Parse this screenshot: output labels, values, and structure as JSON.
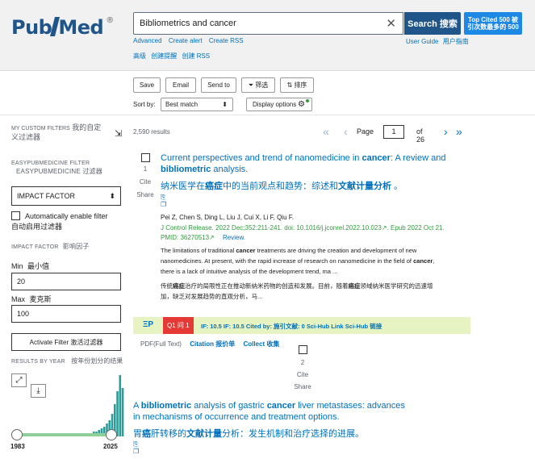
{
  "header": {
    "logo_text_left": "Pub",
    "logo_text_right": "ed",
    "logo_reg": "®",
    "search_value": "Bibliometrics and cancer",
    "search_button": "Search 搜索",
    "top_cited_button": "Top Cited 500 被引次数最多的 500",
    "links": [
      "Advanced",
      "Create alert",
      "Create RSS"
    ],
    "links_cn": [
      "高级",
      "创建提醒",
      "创建 RSS"
    ],
    "guide_links": [
      "User Guide",
      "用户指南"
    ]
  },
  "actions": {
    "save": "Save",
    "email": "Email",
    "send_to": "Send to",
    "filter": "筛选",
    "sort": "排序",
    "sort_by_label": "Sort by:",
    "sort_value": "Best match",
    "display_options": "Display options"
  },
  "sidebar": {
    "my_custom_filters": "MY CUSTOM FILTERS",
    "my_custom_filters_cn": "我的自定义过滤器",
    "easy_filter": "EASYPUBMEDICINE FILTER",
    "easy_filter_cn": "EASYPUBMEDICINE 过滤器",
    "impact_factor_select": "IMPACT FACTOR",
    "auto_enable": "Automatically enable filter",
    "auto_enable_cn": "自动启用过滤器",
    "impact_factor_label": "IMPACT FACTOR",
    "impact_factor_label_cn": "影响因子",
    "min_label": "Min",
    "min_label_cn": "最小值",
    "min_value": "20",
    "max_label": "Max",
    "max_label_cn": "麦克斯",
    "max_value": "100",
    "activate_filter": "Activate Filter 激活过滤器",
    "results_by_year": "RESULTS BY YEAR",
    "results_by_year_cn": "按年份划分的结果",
    "year_start": "1983",
    "year_end": "2025",
    "histogram": [
      0,
      0,
      0,
      0,
      0,
      0,
      0,
      0,
      0,
      0,
      0,
      0,
      0,
      0,
      0,
      0,
      0,
      0,
      0,
      0,
      0,
      0,
      0,
      0,
      1,
      1,
      1,
      1,
      1,
      2,
      2,
      3,
      3,
      4,
      5,
      6,
      8,
      10,
      14,
      20,
      28,
      38,
      30
    ]
  },
  "results": {
    "count": "2,590 results",
    "page_label": "Page",
    "page_value": "1",
    "page_of": "of 26"
  },
  "article1": {
    "number": "1",
    "cite": "Cite",
    "share": "Share",
    "title_a": "Current perspectives and trend of nanomedicine in ",
    "title_b": "cancer",
    "title_c": ": A review and ",
    "title_d": "bibliometric",
    "title_e": " analysis.",
    "title_cn_a": "纳米医学在",
    "title_cn_b": "癌症",
    "title_cn_c": "中的当前观点和趋势：综述和",
    "title_cn_d": "文献计量分析",
    "title_cn_e": " 。",
    "authors": "Pei Z, Chen S, Ding L, Liu J, Cui X, Li F, Qiu F.",
    "journal": "J Control Release. 2022 Dec;352:211-241. doi: 10.1016/j.jconrel.2022.10.023",
    "journal_tail": ". Epub 2022 Oct 21.",
    "pmid": "PMID: 36270513",
    "review": "Review.",
    "abstract_1": "The limitations of traditional ",
    "abstract_1b": "cancer",
    "abstract_1c": " treatments are driving the creation and development of new",
    "abstract_2": "nanomedicines. At present, with the rapid increase of research on nanomedicine in the field of ",
    "abstract_2b": "cancer",
    "abstract_2c": ",",
    "abstract_3": "there is a lack of intuitive analysis of the development trend, ma ...",
    "abstract_cn_1": "传统",
    "abstract_cn_1b": "癌症",
    "abstract_cn_1c": "治疗的局限性正在推动新纳米药物的创造和发展。目前，随着",
    "abstract_cn_1d": "癌症",
    "abstract_cn_1e": "领域纳米医学研究的迅速增",
    "abstract_cn_2": "加，缺乏对发展趋势的直观分析，马..."
  },
  "easybar": {
    "ep": "ΞP",
    "q1": "Q1 问 1",
    "metrics": "IF: 10.5  IF: 10.5   Cited by:  施引文献:  0     Sci-Hub Link  Sci-Hub 链接"
  },
  "links2": {
    "pdf": "PDF(Full Text)",
    "citation": "Citation 报价单",
    "collect": "Collect 收集"
  },
  "article2": {
    "number": "2",
    "cite": "Cite",
    "share": "Share",
    "title_a": "A ",
    "title_b": "bibliometric",
    "title_c": " analysis of gastric ",
    "title_d": "cancer",
    "title_e": " liver metastases: advances in mechanisms of occurrence and treatment options.",
    "title_cn_a": "胃",
    "title_cn_b": "癌",
    "title_cn_c": "肝转移的",
    "title_cn_d": "文献计量",
    "title_cn_e": "分析：发生机制和治疗选择的进展。"
  },
  "colors": {
    "brand": "#20558a",
    "link": "#0071bc",
    "journal_green": "#2e9a3b",
    "easybar_bg": "#e8f3c4",
    "q1_red": "#e53935",
    "histogram_teal": "#2a9d9b"
  }
}
